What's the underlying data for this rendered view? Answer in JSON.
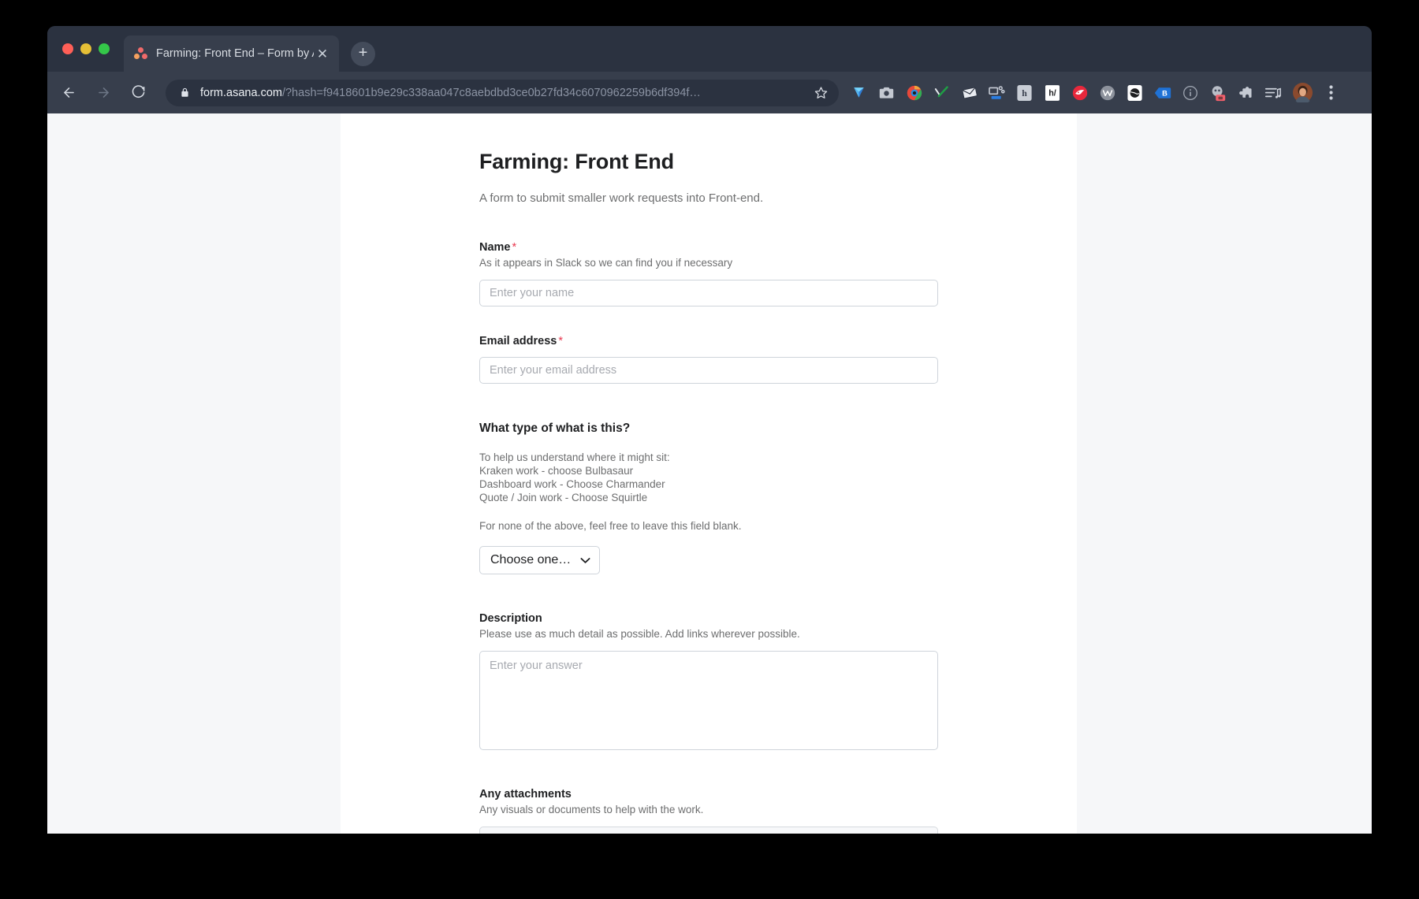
{
  "window": {
    "traffic_lights": [
      "close",
      "minimize",
      "zoom"
    ],
    "tab": {
      "title": "Farming: Front End – Form by A",
      "favicon": "asana-logo-icon",
      "close_label": "✕"
    },
    "new_tab_label": "+"
  },
  "toolbar": {
    "back_label": "back-arrow",
    "forward_label": "forward-arrow",
    "reload_label": "reload",
    "url_domain": "form.asana.com",
    "url_path": "/?hash=f9418601b9e29c338aa047c8aebdbd3ce0b27fd34c6070962259b6df394f…",
    "bookmark_label": "star",
    "extensions": [
      "diamond-icon",
      "camera-icon",
      "chrome-circle-icon",
      "checkmark-icon",
      "envelope-icon",
      "screen-share-icon",
      "h-badge-icon",
      "hypothesis-icon",
      "red-bear-icon",
      "w-circle-icon",
      "globe-icon",
      "blue-tag-icon",
      "info-circle-icon",
      "ghost-avatar-icon",
      "puzzle-piece-icon",
      "playlist-music-icon"
    ],
    "profile_label": "user-avatar",
    "menu_label": "chrome-menu-icon"
  },
  "page": {
    "title": "Farming: Front End",
    "subtitle": "A form to submit smaller work requests into Front-end.",
    "fields": [
      {
        "id": "name",
        "label": "Name",
        "required": true,
        "help": "As it appears in Slack so we can find you if necessary",
        "placeholder": "Enter your name",
        "value": ""
      },
      {
        "id": "email",
        "label": "Email address",
        "required": true,
        "help": "",
        "placeholder": "Enter your email address",
        "value": ""
      }
    ],
    "type_section": {
      "question": "What type of what is this?",
      "help_lines": [
        "To help us understand where it might sit:",
        "Kraken work - choose Bulbasaur",
        "Dashboard work - Choose Charmander",
        "Quote / Join work - Choose Squirtle"
      ],
      "note": "For none of the above, feel free to leave this field blank.",
      "select_value": "Choose one…"
    },
    "description": {
      "label": "Description",
      "help": "Please use as much detail as possible. Add links wherever possible.",
      "placeholder": "Enter your answer",
      "value": ""
    },
    "attachments": {
      "label": "Any attachments",
      "help": "Any visuals or documents to help with the work."
    }
  },
  "colors": {
    "chrome_dark": "#2b3240",
    "chrome_toolbar": "#373e4c",
    "page_bg": "#f6f7f9",
    "card_bg": "#ffffff",
    "required_red": "#e8384f",
    "text_primary": "#1e1f21",
    "text_secondary": "#6d6e6f"
  }
}
